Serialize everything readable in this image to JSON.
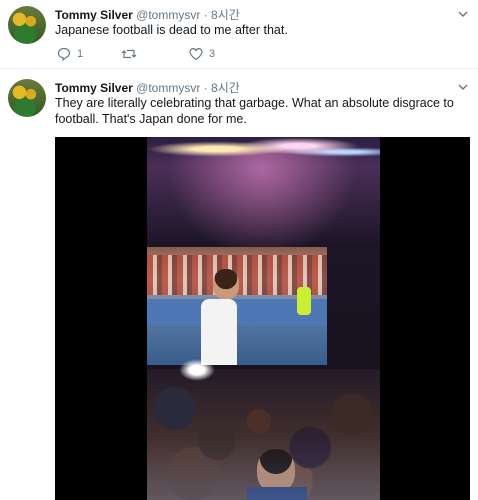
{
  "tweets": [
    {
      "author_name": "Tommy Silver",
      "handle": "@tommysvr",
      "separator": "·",
      "time": "8시간",
      "text": "Japanese football is dead to me after that.",
      "actions": {
        "reply_count": "1",
        "retweet_count": "",
        "like_count": "3"
      }
    },
    {
      "author_name": "Tommy Silver",
      "handle": "@tommysvr",
      "separator": "·",
      "time": "8시간",
      "text": "They are literally celebrating that garbage. What an absolute disgrace to football. That's Japan done for me."
    }
  ],
  "icons": {
    "more": "chevron-down-icon",
    "reply": "reply-icon",
    "retweet": "retweet-icon",
    "like": "heart-icon"
  },
  "colors": {
    "text": "#14171a",
    "secondary": "#657786",
    "divider": "#e6ecf0",
    "icon_blue": "#1da1f2"
  }
}
